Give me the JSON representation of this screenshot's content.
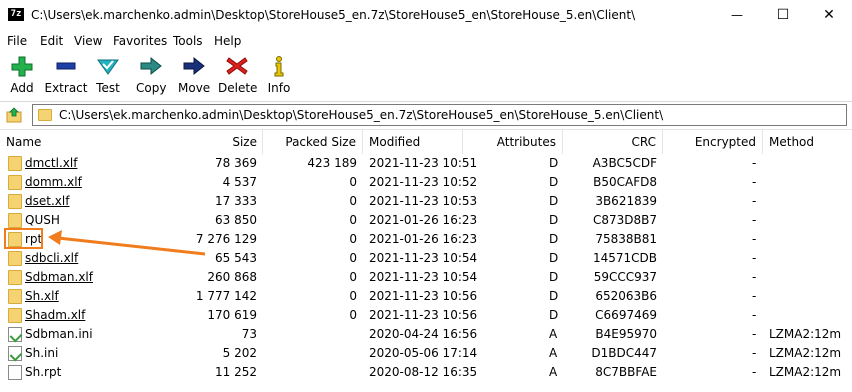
{
  "window": {
    "app_icon_text": "7z",
    "title": "C:\\Users\\ek.marchenko.admin\\Desktop\\StoreHouse5_en.7z\\StoreHouse5_en\\StoreHouse_5.en\\Client\\",
    "minimize": "—",
    "maximize": "☐",
    "close": "✕"
  },
  "menu": [
    "File",
    "Edit",
    "View",
    "Favorites",
    "Tools",
    "Help"
  ],
  "toolbar": {
    "add": "Add",
    "extract": "Extract",
    "test": "Test",
    "copy": "Copy",
    "move": "Move",
    "delete": "Delete",
    "info": "Info"
  },
  "address": {
    "path": "C:\\Users\\ek.marchenko.admin\\Desktop\\StoreHouse5_en.7z\\StoreHouse5_en\\StoreHouse_5.en\\Client\\"
  },
  "columns": {
    "name": "Name",
    "size": "Size",
    "packed": "Packed Size",
    "modified": "Modified",
    "attributes": "Attributes",
    "crc": "CRC",
    "encrypted": "Encrypted",
    "method": "Method"
  },
  "rows": [
    {
      "name": "dmctl.xlf",
      "size": "78 369",
      "packed": "423 189",
      "modified": "2021-11-23 10:51",
      "attr": "D",
      "crc": "A3BC5CDF",
      "enc": "-",
      "method": "",
      "type": "folder"
    },
    {
      "name": "domm.xlf",
      "size": "4 537",
      "packed": "0",
      "modified": "2021-11-23 10:52",
      "attr": "D",
      "crc": "B50CAFD8",
      "enc": "-",
      "method": "",
      "type": "folder"
    },
    {
      "name": "dset.xlf",
      "size": "17 333",
      "packed": "0",
      "modified": "2021-11-23 10:53",
      "attr": "D",
      "crc": "3B621839",
      "enc": "-",
      "method": "",
      "type": "folder"
    },
    {
      "name": "QUSH",
      "size": "63 850",
      "packed": "0",
      "modified": "2021-01-26 16:23",
      "attr": "D",
      "crc": "C873D8B7",
      "enc": "-",
      "method": "",
      "type": "folder"
    },
    {
      "name": "rpt",
      "size": "7 276 129",
      "packed": "0",
      "modified": "2021-01-26 16:23",
      "attr": "D",
      "crc": "75838B81",
      "enc": "-",
      "method": "",
      "type": "folder"
    },
    {
      "name": "sdbcli.xlf",
      "size": "65 543",
      "packed": "0",
      "modified": "2021-11-23 10:54",
      "attr": "D",
      "crc": "14571CDB",
      "enc": "-",
      "method": "",
      "type": "folder"
    },
    {
      "name": "Sdbman.xlf",
      "size": "260 868",
      "packed": "0",
      "modified": "2021-11-23 10:54",
      "attr": "D",
      "crc": "59CCC937",
      "enc": "-",
      "method": "",
      "type": "folder"
    },
    {
      "name": "Sh.xlf",
      "size": "1 777 142",
      "packed": "0",
      "modified": "2021-11-23 10:56",
      "attr": "D",
      "crc": "652063B6",
      "enc": "-",
      "method": "",
      "type": "folder"
    },
    {
      "name": "Shadm.xlf",
      "size": "170 619",
      "packed": "0",
      "modified": "2021-11-23 10:56",
      "attr": "D",
      "crc": "C6697469",
      "enc": "-",
      "method": "",
      "type": "folder"
    },
    {
      "name": "Sdbman.ini",
      "size": "73",
      "packed": "",
      "modified": "2020-04-24 16:56",
      "attr": "A",
      "crc": "B4E95970",
      "enc": "-",
      "method": "LZMA2:12m",
      "type": "ini"
    },
    {
      "name": "Sh.ini",
      "size": "5 202",
      "packed": "",
      "modified": "2020-05-06 17:14",
      "attr": "A",
      "crc": "D1BDC447",
      "enc": "-",
      "method": "LZMA2:12m",
      "type": "ini"
    },
    {
      "name": "Sh.rpt",
      "size": "11 252",
      "packed": "",
      "modified": "2020-08-12 16:35",
      "attr": "A",
      "crc": "8C7BBFAE",
      "enc": "-",
      "method": "LZMA2:12m",
      "type": "doc"
    }
  ],
  "colors": {
    "highlight": "#f07c1e",
    "folder": "#f5d372",
    "add": "#22b14c",
    "extract": "#1f3fa8",
    "test": "#25b3c4",
    "delete": "#e0201d",
    "info": "#e8c800"
  }
}
